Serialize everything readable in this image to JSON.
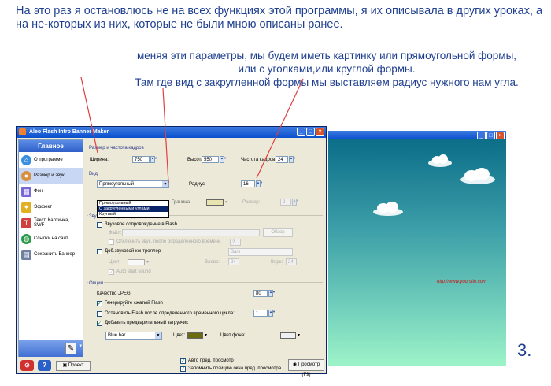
{
  "captions": {
    "line1": "На это раз я остановлюсь не на всех функциях этой программы, я их описывала в других уроках, а на не-которых из них, которые не были мною описаны ранее.",
    "line2": "меняя эти параметры, мы будем иметь картинку или прямоугольной формы, или с уголками,или круглой формы.",
    "line3": "Там где вид с закругленной формы мы выставляем радиус нужного нам угла.",
    "number": "3."
  },
  "window": {
    "title": "Aleo Flash Intro Banner Maker",
    "controls": [
      "_",
      "□",
      "×"
    ]
  },
  "sidebar": {
    "heading": "Главное",
    "items": [
      {
        "label": "О программе",
        "icon": "home-icon",
        "color": "#3a8ee0"
      },
      {
        "label": "Размер и звук",
        "icon": "palette-icon",
        "color": "#d89040"
      },
      {
        "label": "Фон",
        "icon": "background-icon",
        "color": "#7a68d8"
      },
      {
        "label": "Эффект",
        "icon": "effect-icon",
        "color": "#e0b020"
      },
      {
        "label": "Текст, Картинка, SWF",
        "icon": "text-image-icon",
        "color": "#d04040"
      },
      {
        "label": "Ссылки на сайт",
        "icon": "globe-icon",
        "color": "#2a9a4a"
      },
      {
        "label": "Сохранить Баннер",
        "icon": "save-icon",
        "color": "#7080a0"
      }
    ]
  },
  "size": {
    "group_title": "Размер и частота кадров",
    "width_label": "Ширина:",
    "width_value": "750",
    "height_label": "Высота:",
    "height_value": "550",
    "fps_label": "Частота кадров:",
    "fps_value": "24"
  },
  "shape": {
    "group_title": "Вид",
    "selected": "Прямоугольный",
    "options": [
      "Прямоугольный",
      "С закругленными углами",
      "Круглый"
    ],
    "radius_label": "Радиус:",
    "radius_value": "16",
    "border_label": "Граница",
    "size_label": "Размер:",
    "size_value": "2"
  },
  "sound": {
    "group_title": "Звуковое сопровождение",
    "flash_sound_label": "Звуковое сопровождение в Flash",
    "file_label": "Файл:",
    "browse_label": "Обзор",
    "off_after_label": "Отключить звук, после определенного времени",
    "off_after_value": "2",
    "controller_label": "Доб.звуковой контроллер",
    "controller_style": "Bars",
    "color_label": "Цвет:",
    "left_label": "Влево:",
    "left_value": "24",
    "top_label": "Верх:",
    "top_value": "24",
    "autostart_label": "Auto start sound"
  },
  "options": {
    "group_title": "Опции",
    "jpeg_label": "Качество JPEG:",
    "jpeg_value": "80",
    "compressed_label": "Генерируйте сжатый Flash",
    "stop_label": "Остановить Flash после определенного временного цикла:",
    "stop_value": "1",
    "preloader_label": "Добавить предварительный загрузчик",
    "preloader_style": "Blue bar",
    "color_label": "Цвет:",
    "color_hex": "#6b6b10",
    "bg_color_label": "Цвет фона:",
    "bg_color_hex": "#f0f0f0"
  },
  "bottom": {
    "project_label": "Проект",
    "auto_preview_label": "Авто пред. просмотр",
    "remember_pos_label": "Запомнить позицию окна пред. просмотра",
    "preview_button_label": "Просмотр (F9)"
  },
  "preview_window": {
    "link_text": "http://www.yoursite.com"
  },
  "colors": {
    "caption": "#1f3f8f",
    "arrow": "#e04040",
    "titlebar": "#0a4fce"
  }
}
